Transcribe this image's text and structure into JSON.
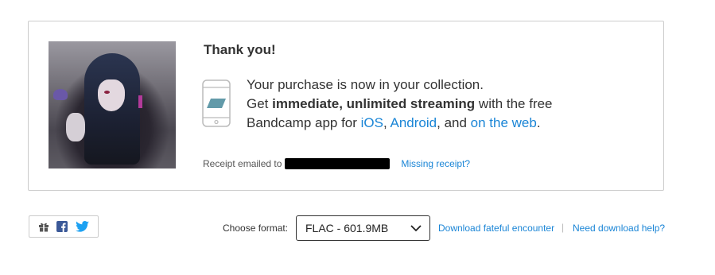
{
  "thank_you": {
    "title": "Thank you!",
    "line1": "Your purchase is now in your collection.",
    "line2_prefix": "Get ",
    "line2_bold": "immediate, unlimited streaming",
    "line2_suffix": " with the free",
    "line3_prefix": "Bandcamp app for ",
    "link_ios": "iOS",
    "comma": ", ",
    "link_android": "Android",
    "and_text": ", and ",
    "link_web": "on the web",
    "period": "."
  },
  "receipt": {
    "label": "Receipt emailed to",
    "missing_link": "Missing receipt?"
  },
  "share": {
    "icons": [
      "gift-icon",
      "facebook-icon",
      "twitter-icon"
    ]
  },
  "download": {
    "format_label": "Choose format:",
    "selected_format": "FLAC - 601.9MB",
    "download_link": "Download fateful encounter",
    "separator": "|",
    "help_link": "Need download help?"
  },
  "colors": {
    "link": "#1a85d6",
    "text": "#333333",
    "border": "#cccccc",
    "facebook": "#3b5998",
    "twitter": "#1da1f2"
  }
}
